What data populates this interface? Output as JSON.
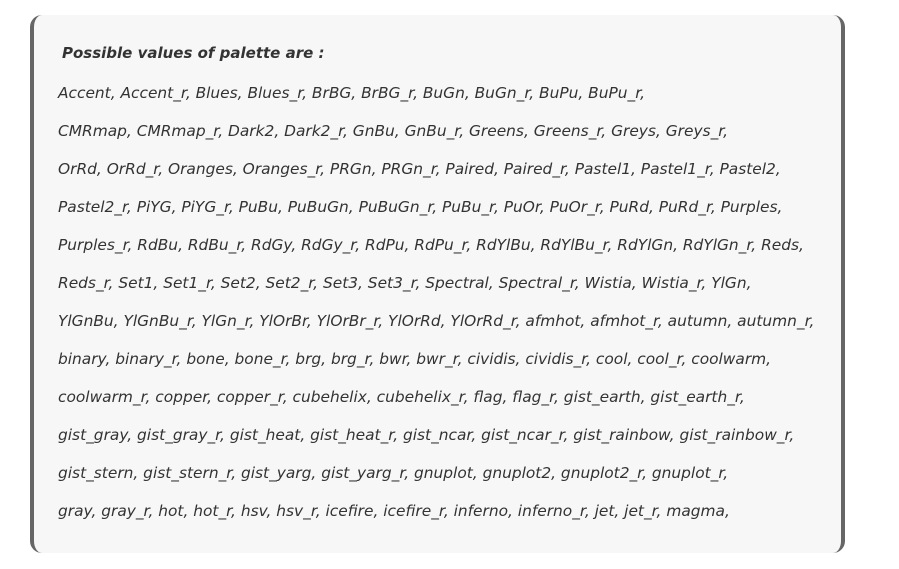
{
  "note": {
    "heading": "Possible values of palette are :",
    "lines": [
      "Accent, Accent_r, Blues, Blues_r, BrBG, BrBG_r, BuGn, BuGn_r, BuPu, BuPu_r,",
      "CMRmap, CMRmap_r, Dark2, Dark2_r, GnBu, GnBu_r, Greens, Greens_r, Greys, Greys_r,",
      "OrRd, OrRd_r, Oranges, Oranges_r, PRGn, PRGn_r, Paired, Paired_r, Pastel1, Pastel1_r, Pastel2,",
      "Pastel2_r, PiYG, PiYG_r, PuBu, PuBuGn, PuBuGn_r, PuBu_r, PuOr, PuOr_r, PuRd, PuRd_r, Purples,",
      "Purples_r, RdBu, RdBu_r, RdGy, RdGy_r, RdPu, RdPu_r, RdYlBu, RdYlBu_r, RdYlGn, RdYlGn_r, Reds,",
      "Reds_r, Set1, Set1_r, Set2, Set2_r, Set3, Set3_r, Spectral, Spectral_r, Wistia, Wistia_r, YlGn,",
      "YlGnBu, YlGnBu_r, YlGn_r, YlOrBr, YlOrBr_r, YlOrRd, YlOrRd_r, afmhot, afmhot_r, autumn, autumn_r,",
      "binary, binary_r, bone, bone_r, brg, brg_r, bwr, bwr_r, cividis, cividis_r, cool, cool_r, coolwarm,",
      "coolwarm_r, copper, copper_r, cubehelix, cubehelix_r, flag, flag_r, gist_earth, gist_earth_r,",
      "gist_gray, gist_gray_r, gist_heat, gist_heat_r, gist_ncar, gist_ncar_r, gist_rainbow, gist_rainbow_r,",
      "gist_stern, gist_stern_r, gist_yarg, gist_yarg_r, gnuplot, gnuplot2, gnuplot2_r, gnuplot_r,",
      "gray, gray_r, hot, hot_r, hsv, hsv_r, icefire, icefire_r, inferno, inferno_r, jet, jet_r, magma,"
    ]
  },
  "colors": {
    "background": "#f7f7f7",
    "border": "#666666",
    "text": "#333333"
  }
}
